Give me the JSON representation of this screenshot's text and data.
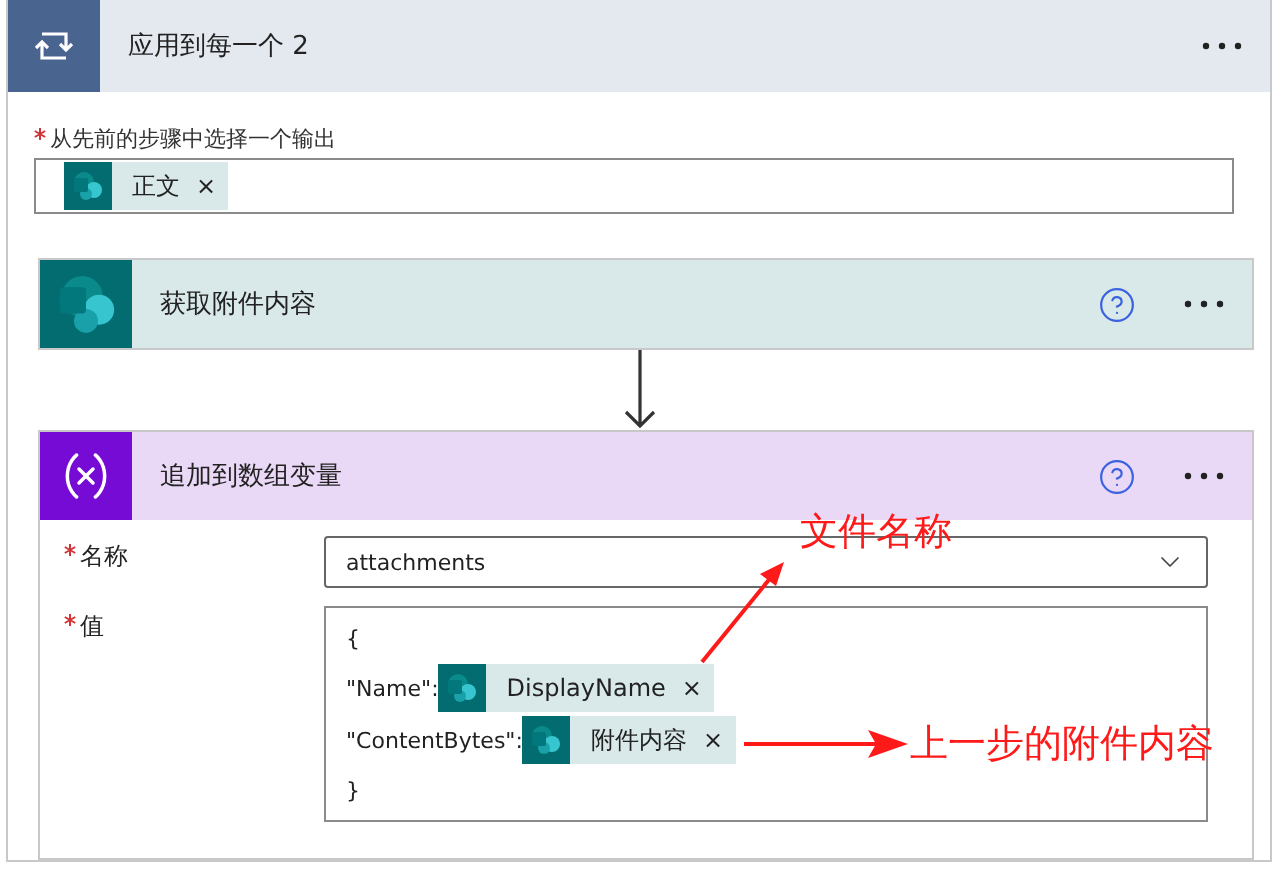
{
  "loop": {
    "title": "应用到每一个 2",
    "field_label": "从先前的步骤中选择一个输出",
    "required": true,
    "tokens": [
      {
        "label": "正文",
        "remove": "×"
      }
    ]
  },
  "steps": [
    {
      "kind": "sharepoint",
      "title": "获取附件内容"
    },
    {
      "kind": "variable",
      "title": "追加到数组变量",
      "fields": [
        {
          "kind": "dropdown",
          "label": "名称",
          "required": true,
          "value": "attachments"
        },
        {
          "kind": "expression",
          "label": "值",
          "required": true,
          "lines": [
            {
              "text": "{"
            },
            {
              "text": "\"Name\":",
              "token": {
                "label": "DisplayName",
                "remove": "×"
              }
            },
            {
              "text": "\"ContentBytes\":",
              "token": {
                "label": "附件内容",
                "remove": "×"
              }
            },
            {
              "text": "}"
            }
          ]
        }
      ]
    }
  ],
  "annotations": [
    {
      "text": "文件名称"
    },
    {
      "text": "上一步的附件内容"
    }
  ]
}
